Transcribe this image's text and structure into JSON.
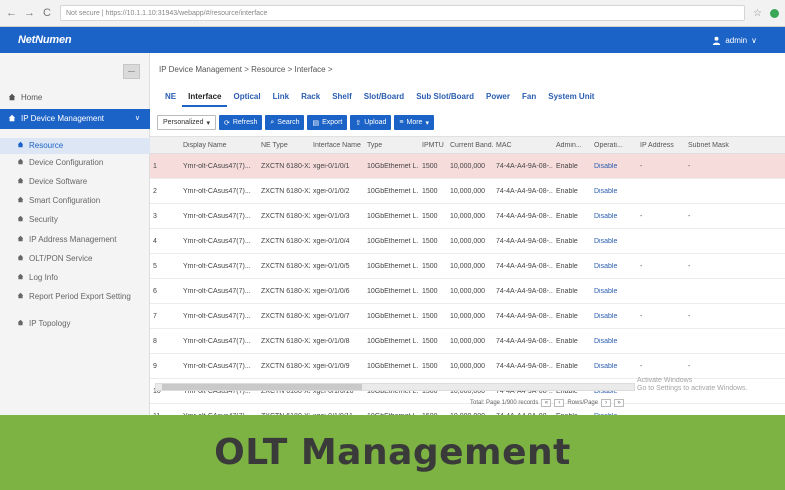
{
  "browser": {
    "address": "Not secure | https://10.1.1.10:31943/webapp/#/resource/interface",
    "back_glyph": "←",
    "forward_glyph": "→",
    "reload_glyph": "C",
    "star_glyph": "☆"
  },
  "header": {
    "logo": "NetNumen",
    "user": "admin",
    "user_chevron": "∨"
  },
  "sidebar": {
    "collapse_glyph": "—",
    "home": "Home",
    "parent": "IP Device Management",
    "parent_chevron": "∨",
    "items": [
      {
        "label": "Resource",
        "active": true
      },
      {
        "label": "Device Configuration",
        "active": false
      },
      {
        "label": "Device Software",
        "active": false
      },
      {
        "label": "Smart Configuration",
        "active": false
      },
      {
        "label": "Security",
        "active": false
      },
      {
        "label": "IP Address Management",
        "active": false
      },
      {
        "label": "OLT/PON Service",
        "active": false
      },
      {
        "label": "Log Info",
        "active": false
      },
      {
        "label": "Report Period Export Setting",
        "active": false
      },
      {
        "label": "IP Topology",
        "active": false
      }
    ]
  },
  "main": {
    "breadcrumb": "IP Device Management  >  Resource  >  Interface  >",
    "tabs": [
      {
        "label": "NE",
        "active": false
      },
      {
        "label": "Interface",
        "active": true
      },
      {
        "label": "Optical",
        "active": false
      },
      {
        "label": "Link",
        "active": false
      },
      {
        "label": "Rack",
        "active": false
      },
      {
        "label": "Shelf",
        "active": false
      },
      {
        "label": "Slot/Board",
        "active": false
      },
      {
        "label": "Sub Slot/Board",
        "active": false
      },
      {
        "label": "Power",
        "active": false
      },
      {
        "label": "Fan",
        "active": false
      },
      {
        "label": "System Unit",
        "active": false
      }
    ],
    "toolbar": {
      "filter_label": "Personalized",
      "filter_caret": "▾",
      "refresh": "Refresh",
      "search": "Search",
      "export": "Export",
      "upload": "Upload",
      "more": "More",
      "more_caret": "▾"
    },
    "table": {
      "headers": [
        "",
        "Display Name",
        "NE Type",
        "Interface Name",
        "Type",
        "IPMTU",
        "Current Band...",
        "MAC",
        "Admin...",
        "Operati...",
        "IP Address",
        "Subnet Mask"
      ],
      "rows": [
        [
          "1",
          "Ymr-olt-CAsus47(7)...",
          "ZXCTN 6180-X2...",
          "xgei-0/1/0/1",
          "10GbEthernet L...",
          "1500",
          "10,000,000",
          "74-4A-A4-9A-08-...",
          "Enable",
          "Disable",
          "-",
          "-"
        ],
        [
          "2",
          "Ymr-olt-CAsus47(7)...",
          "ZXCTN 6180-X2...",
          "xgei-0/1/0/2",
          "10GbEthernet L...",
          "1500",
          "10,000,000",
          "74-4A-A4-9A-08-...",
          "Enable",
          "Disable",
          "",
          ""
        ],
        [
          "3",
          "Ymr-olt-CAsus47(7)...",
          "ZXCTN 6180-X2...",
          "xgei-0/1/0/3",
          "10GbEthernet L...",
          "1500",
          "10,000,000",
          "74-4A-A4-9A-08-...",
          "Enable",
          "Disable",
          "-",
          "-"
        ],
        [
          "4",
          "Ymr-olt-CAsus47(7)...",
          "ZXCTN 6180-X2...",
          "xgei-0/1/0/4",
          "10GbEthernet L...",
          "1500",
          "10,000,000",
          "74-4A-A4-9A-08-...",
          "Enable",
          "Disable",
          "",
          ""
        ],
        [
          "5",
          "Ymr-olt-CAsus47(7)...",
          "ZXCTN 6180-X2...",
          "xgei-0/1/0/5",
          "10GbEthernet L...",
          "1500",
          "10,000,000",
          "74-4A-A4-9A-08-...",
          "Enable",
          "Disable",
          "-",
          "-"
        ],
        [
          "6",
          "Ymr-olt-CAsus47(7)...",
          "ZXCTN 6180-X2...",
          "xgei-0/1/0/6",
          "10GbEthernet L...",
          "1500",
          "10,000,000",
          "74-4A-A4-9A-08-...",
          "Enable",
          "Disable",
          "",
          ""
        ],
        [
          "7",
          "Ymr-olt-CAsus47(7)...",
          "ZXCTN 6180-X2...",
          "xgei-0/1/0/7",
          "10GbEthernet L...",
          "1500",
          "10,000,000",
          "74-4A-A4-9A-08-...",
          "Enable",
          "Disable",
          "-",
          "-"
        ],
        [
          "8",
          "Ymr-olt-CAsus47(7)...",
          "ZXCTN 6180-X2...",
          "xgei-0/1/0/8",
          "10GbEthernet L...",
          "1500",
          "10,000,000",
          "74-4A-A4-9A-08-...",
          "Enable",
          "Disable",
          "",
          ""
        ],
        [
          "9",
          "Ymr-olt-CAsus47(7)...",
          "ZXCTN 6180-X2...",
          "xgei-0/1/0/9",
          "10GbEthernet L...",
          "1500",
          "10,000,000",
          "74-4A-A4-9A-08-...",
          "Enable",
          "Disable",
          "-",
          "-"
        ],
        [
          "10",
          "Ymr-olt-CAsus47(7)...",
          "ZXCTN 6180-X2...",
          "xgei-0/1/0/10",
          "10GbEthernet L...",
          "1500",
          "10,000,000",
          "74-4A-A4-9A-08-...",
          "Enable",
          "Disable",
          "",
          ""
        ],
        [
          "11",
          "Ymr-olt-CAsus47(7)...",
          "ZXCTN 6180-X2...",
          "xgei-0/1/0/11",
          "10GbEthernet L...",
          "1500",
          "10,000,000",
          "74-4A-A4-9A-08-...",
          "Enable",
          "Disable",
          "-",
          "-"
        ]
      ]
    },
    "pager": {
      "summary": "Total: Page 1/900 records",
      "per_page": "Rows/Page",
      "first": "«",
      "prev": "‹",
      "next": "›",
      "last": "»"
    },
    "watermark": {
      "line1": "Activate Windows",
      "line2": "Go to Settings to activate Windows."
    }
  },
  "banner": {
    "text": "OLT Management"
  },
  "colors": {
    "brand": "#1c63c7",
    "banner": "#7cb342",
    "selected_row": "#f7dcdc"
  }
}
